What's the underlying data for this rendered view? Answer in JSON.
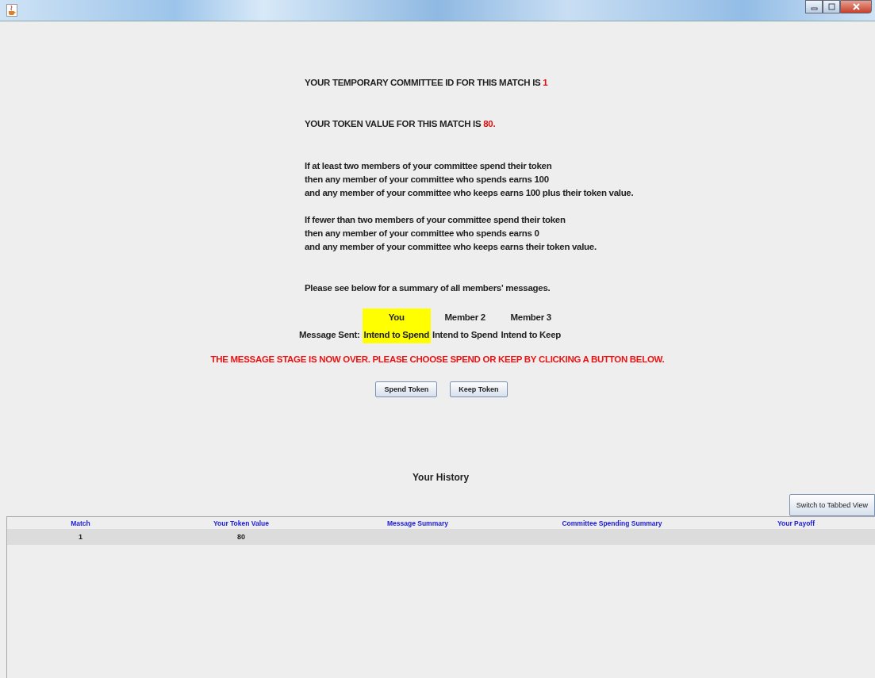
{
  "committee_id": {
    "text": "YOUR TEMPORARY COMMITTEE ID FOR THIS MATCH IS ",
    "value": "1"
  },
  "token_value": {
    "text": "YOUR TOKEN VALUE FOR THIS MATCH IS ",
    "value": "80."
  },
  "rules": [
    [
      "If at least two members of your committee spend their token",
      "then any member of your committee who spends earns 100",
      "and any member of your committee who keeps earns 100 plus their token value."
    ],
    [
      "If fewer than two members of your committee spend their token",
      "then any member of your committee who spends earns 0",
      "and any member of your committee who keeps earns their token value."
    ]
  ],
  "summary_intro": "Please see below for a summary of all members' messages.",
  "messages": {
    "row_label": "Message Sent:",
    "members": [
      {
        "name": "You",
        "message": "Intend to Spend",
        "selected": true
      },
      {
        "name": "Member 2",
        "message": "Intend to Spend",
        "selected": false
      },
      {
        "name": "Member 3",
        "message": "Intend to Keep",
        "selected": false
      }
    ]
  },
  "notice": "THE MESSAGE STAGE IS NOW OVER. PLEASE CHOOSE SPEND OR KEEP BY CLICKING A BUTTON BELOW.",
  "buttons": [
    "Spend Token",
    "Keep Token"
  ],
  "history": {
    "title": "Your History",
    "switch_button": "Switch to Tabbed View",
    "table": {
      "columns": [
        "Match",
        "Your Token Value",
        "Message Summary",
        "Committee Spending Summary",
        "Your Payoff"
      ],
      "rows": [
        [
          "1",
          "80"
        ]
      ]
    }
  }
}
